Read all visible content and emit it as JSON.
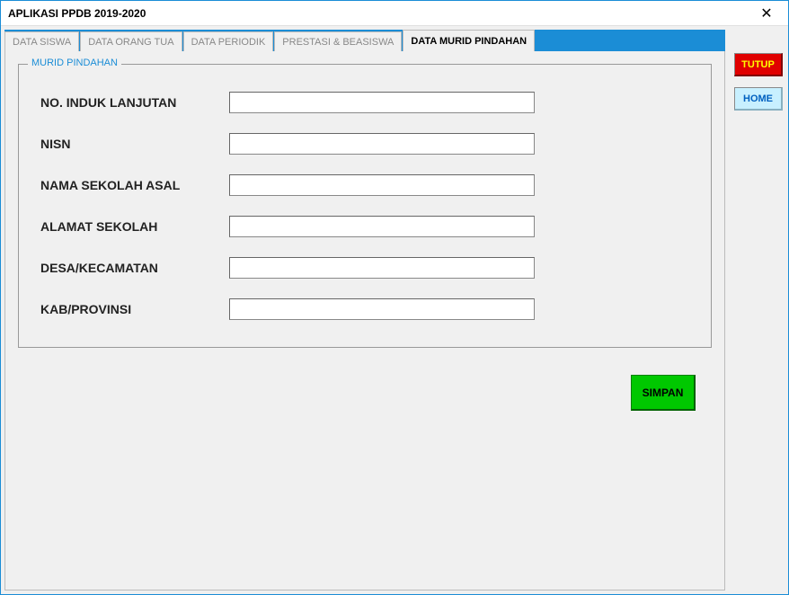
{
  "window": {
    "title": "APLIKASI PPDB 2019-2020"
  },
  "tabs": [
    {
      "label": "DATA SISWA"
    },
    {
      "label": "DATA ORANG TUA"
    },
    {
      "label": "DATA PERIODIK"
    },
    {
      "label": "PRESTASI & BEASISWA"
    },
    {
      "label": "DATA MURID PINDAHAN"
    }
  ],
  "fieldset": {
    "legend": "MURID PINDAHAN",
    "fields": {
      "no_induk": {
        "label": "NO. INDUK LANJUTAN",
        "value": ""
      },
      "nisn": {
        "label": "NISN",
        "value": ""
      },
      "nama_sekolah": {
        "label": "NAMA SEKOLAH ASAL",
        "value": ""
      },
      "alamat_sekolah": {
        "label": "ALAMAT SEKOLAH",
        "value": ""
      },
      "desa": {
        "label": "DESA/KECAMATAN",
        "value": ""
      },
      "kab": {
        "label": "KAB/PROVINSI",
        "value": ""
      }
    }
  },
  "buttons": {
    "simpan": "SIMPAN",
    "tutup": "TUTUP",
    "home": "HOME"
  }
}
